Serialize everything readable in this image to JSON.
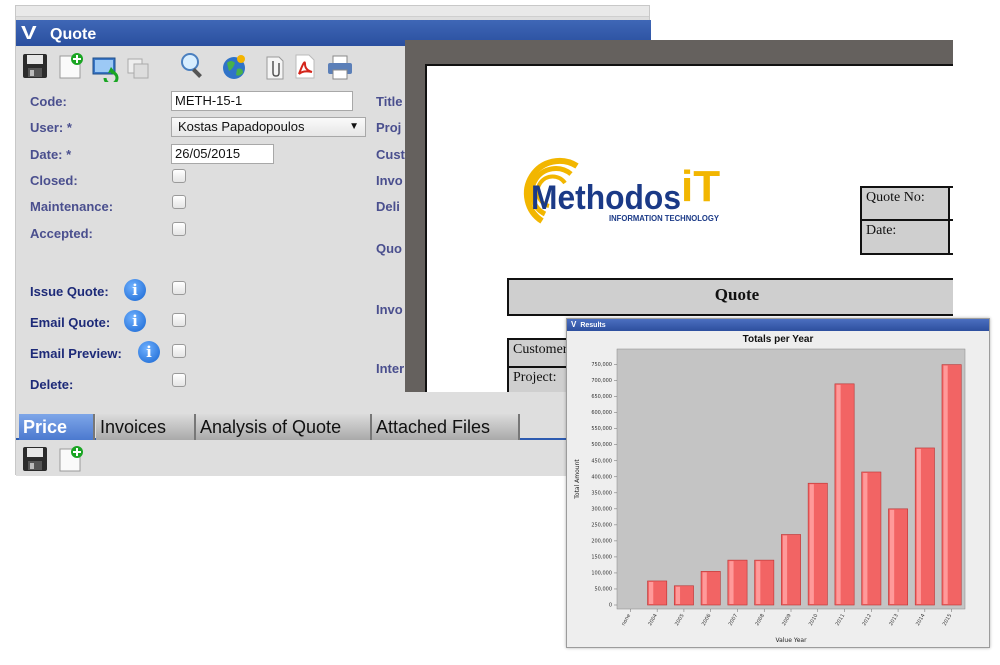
{
  "quote_window": {
    "title": "Quote",
    "toolbar_icons": [
      "save-icon",
      "new-document-icon",
      "refresh-icon",
      "copy-icon",
      "search-icon",
      "globe-icon",
      "attachment-icon",
      "pdf-icon",
      "print-icon"
    ],
    "fields": {
      "code_label": "Code:",
      "code_value": "METH-15-1",
      "user_label": "User: *",
      "user_value": "Kostas Papadopoulos",
      "date_label": "Date: *",
      "date_value": "26/05/2015",
      "closed_label": "Closed:",
      "maintenance_label": "Maintenance:",
      "accepted_label": "Accepted:",
      "issue_quote_label": "Issue Quote:",
      "email_quote_label": "Email Quote:",
      "email_preview_label": "Email Preview:",
      "delete_label": "Delete:"
    },
    "right_labels": [
      "Title",
      "Proj",
      "Cust",
      "Invo",
      "Deli",
      "Quo",
      "Invo",
      "Inter"
    ],
    "tabs": [
      "Price",
      "Invoices",
      "Analysis of Quote",
      "Attached Files"
    ],
    "active_tab": "Price"
  },
  "report": {
    "logo_text": "Methodos",
    "logo_accent": "iT",
    "logo_tagline": "INFORMATION TECHNOLOGY",
    "quote_no_label": "Quote No:",
    "date_label": "Date:",
    "heading": "Quote",
    "customer_label": "Customer",
    "project_label": "Project:"
  },
  "results_window": {
    "title": "Results"
  },
  "chart_data": {
    "type": "bar",
    "title": "Totals per Year",
    "xlabel": "Value Year",
    "ylabel": "Total Amount",
    "categories": [
      "none",
      "2004",
      "2005",
      "2006",
      "2007",
      "2008",
      "2009",
      "2010",
      "2011",
      "2012",
      "2013",
      "2014",
      "2015"
    ],
    "values": [
      0,
      75000,
      60000,
      105000,
      140000,
      140000,
      220000,
      380000,
      690000,
      415000,
      300000,
      490000,
      750000
    ],
    "yticks": [
      "0",
      "50,000",
      "100,000",
      "150,000",
      "200,000",
      "250,000",
      "300,000",
      "350,000",
      "400,000",
      "450,000",
      "500,000",
      "550,000",
      "600,000",
      "650,000",
      "700,000",
      "750,000"
    ],
    "ylim": [
      0,
      780000
    ],
    "bar_color": "#f26464",
    "plot_background": "#c4c4c4",
    "grid": false
  }
}
